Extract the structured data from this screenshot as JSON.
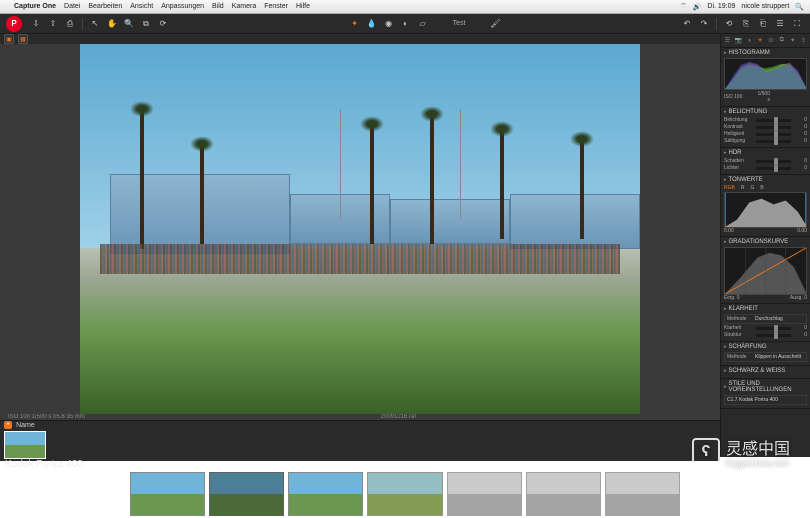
{
  "menubar": {
    "app": "Capture One",
    "items": [
      "Datei",
      "Bearbeiten",
      "Ansicht",
      "Anpassungen",
      "Bild",
      "Kamera",
      "Fenster",
      "Hilfe"
    ],
    "time": "Di. 19:09",
    "user": "nicole struppert"
  },
  "toolbar": {
    "doc_title": "Test"
  },
  "viewer": {
    "info_left": "ISO 100   1/500 s   f/5.6   35 mm",
    "filename": "20091216.raf",
    "info_right": ""
  },
  "browser": {
    "name_label": "Name",
    "tag": "•"
  },
  "filmstrip": {
    "caption": "Kodak Portra 400"
  },
  "panels": {
    "histogram": {
      "title": "Histogramm",
      "iso": "ISO 100",
      "shutter": "1/500 s"
    },
    "exposure": {
      "title": "Belichtung",
      "rows": [
        {
          "label": "Belichtung",
          "val": "0"
        },
        {
          "label": "Kontrast",
          "val": "0"
        },
        {
          "label": "Helligkeit",
          "val": "0"
        },
        {
          "label": "Sättigung",
          "val": "0"
        }
      ]
    },
    "hdr": {
      "title": "HDR",
      "rows": [
        {
          "label": "Schatten",
          "val": "0"
        },
        {
          "label": "Lichter",
          "val": "0"
        }
      ]
    },
    "levels": {
      "title": "Tonwerte",
      "r": "0.00",
      "g": "",
      "b": "0.00"
    },
    "curve": {
      "title": "Gradationskurve",
      "eng": "Eing.  0",
      "ausg": "Ausg.  0"
    },
    "clarity": {
      "title": "Klarheit",
      "rows": [
        {
          "label": "Methode",
          "val": "Durchschlag"
        },
        {
          "label": "Klarheit",
          "val": "0"
        },
        {
          "label": "Struktur",
          "val": "0"
        }
      ]
    },
    "sharpening": {
      "title": "Schärfung",
      "row": {
        "label": "Methode",
        "val": "Klippen in Ausschnitt"
      }
    },
    "bw": {
      "title": "Schwarz & Weiss"
    },
    "styles": {
      "title": "Stile und Voreinstellungen",
      "preset": "C1.7 Kodak Portra 400"
    }
  },
  "watermark": {
    "main": "灵感中国",
    "sub": "lingganchina.com"
  }
}
